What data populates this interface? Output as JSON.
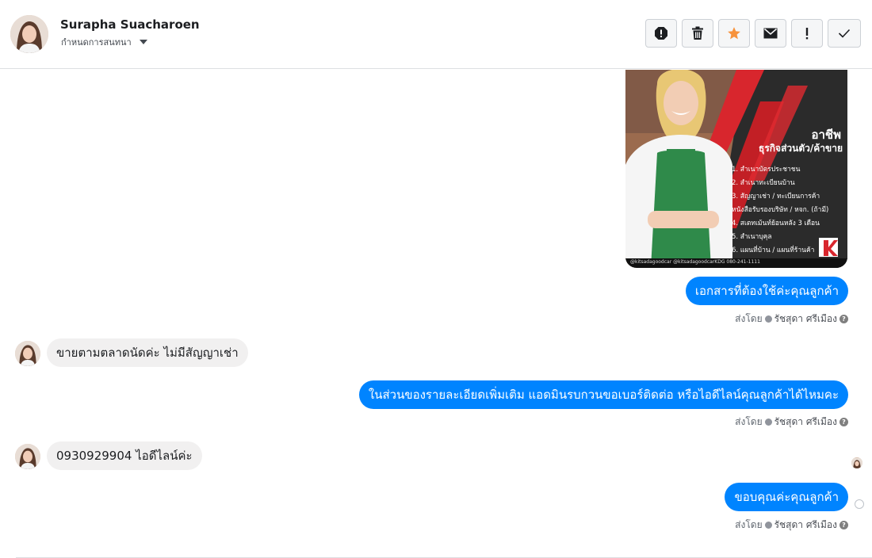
{
  "header": {
    "contact_name": "Surapha Suacharoen",
    "assign_label": "กำหนดการสนทนา",
    "actions": [
      {
        "name": "report-spam-icon"
      },
      {
        "name": "trash-icon"
      },
      {
        "name": "star-icon"
      },
      {
        "name": "envelope-icon"
      },
      {
        "name": "exclamation-icon"
      },
      {
        "name": "check-icon"
      }
    ]
  },
  "poster": {
    "title": "อาชีพ",
    "subtitle": "ธุรกิจส่วนตัว/ค้าขาย",
    "items": [
      "1. สำเนาบัตรประชาชน",
      "2. สำเนาทะเบียนบ้าน",
      "3. สัญญาเช่า / ทะเบียนการค้า",
      "หนังสือรับรองบริษัท / หจก. (ถ้ามี)",
      "4. สเตทเม้นท์ย้อนหลัง 3 เดือน",
      "5. สำเนาบุคุล",
      "6. แผนที่บ้าน / แผนที่ร้านค้า"
    ],
    "footer": "@kitsadagoodcar   @kitsadagoodcarKDG   080-241-1111"
  },
  "messages": {
    "m1": "เอกสารที่ต้องใช้ค่ะคุณลูกค้า",
    "m2": "ขายตามตลาดนัดค่ะ ไม่มีสัญญาเช่า",
    "m3": "ในส่วนของรายละเอียดเพิ่มเติม แอดมินรบกวนขอเบอร์ติดต่อ หรือไอดีไลน์คุณลูกค้าได้ไหมคะ",
    "m4": "0930929904 ไอดีไลน์ค่ะ",
    "m5": "ขอบคุณค่ะคุณลูกค้า"
  },
  "sent_by": {
    "prefix": "ส่งโดย",
    "name": "รัชสุดา ศรีเมือง",
    "help": "?"
  },
  "colors": {
    "outgoing": "#0084ff",
    "incoming": "#f1f0f0",
    "star": "#f7923b"
  }
}
